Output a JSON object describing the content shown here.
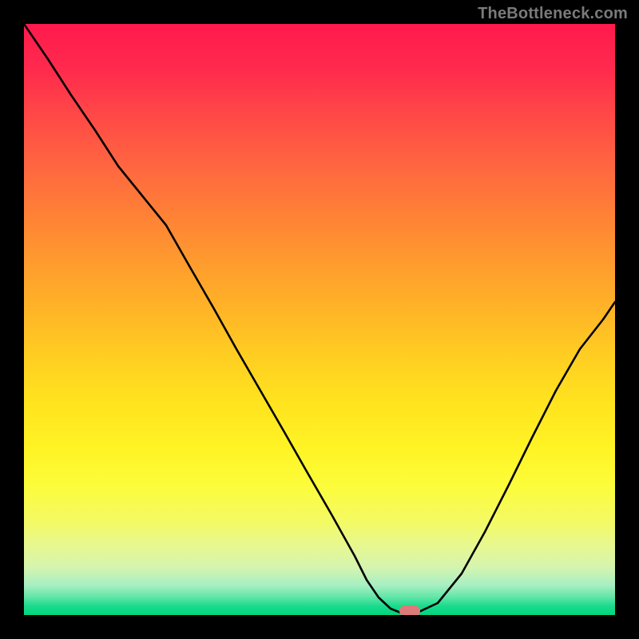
{
  "watermark": "TheBottleneck.com",
  "colors": {
    "page_bg": "#000000",
    "curve": "#000000",
    "marker": "#dd7a79",
    "gradient_top": "#ff1a4d",
    "gradient_bottom": "#00d67f",
    "watermark": "#7a7a7a"
  },
  "chart_data": {
    "type": "line",
    "title": "",
    "xlabel": "",
    "ylabel": "",
    "xlim": [
      0,
      100
    ],
    "ylim": [
      0,
      100
    ],
    "grid": false,
    "legend": false,
    "background": "vertical-gradient red→yellow→green (value 100→0)",
    "series": [
      {
        "name": "bottleneck-curve",
        "x": [
          0,
          4,
          8,
          12,
          16,
          20,
          24,
          28,
          32,
          36,
          40,
          44,
          48,
          52,
          56,
          58,
          60,
          62,
          64,
          66,
          70,
          74,
          78,
          82,
          86,
          90,
          94,
          98,
          100
        ],
        "y": [
          100,
          94,
          88,
          82,
          76,
          71,
          66,
          59,
          52,
          45,
          38,
          31,
          24,
          17,
          10,
          6,
          3,
          1,
          0,
          0,
          2,
          7,
          14,
          22,
          30,
          38,
          45,
          50,
          53
        ]
      }
    ],
    "annotations": [
      {
        "name": "optimal-marker",
        "x": 65,
        "y": 0,
        "shape": "rounded-rect",
        "color": "#dd7a79"
      }
    ]
  }
}
